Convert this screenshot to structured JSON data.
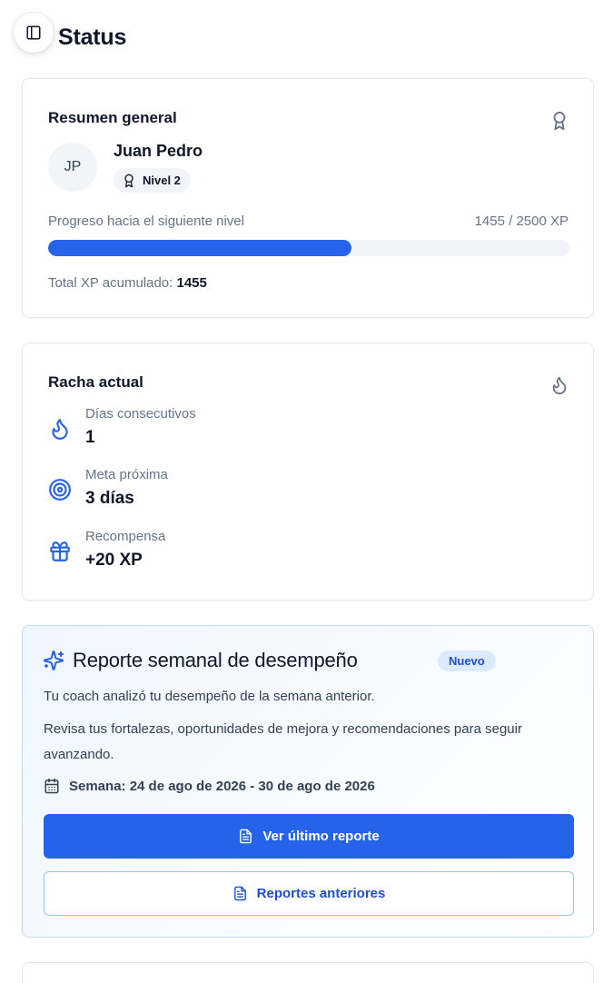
{
  "header": {
    "title": "Status",
    "toggle_icon": "sidebar-toggle-icon"
  },
  "summary": {
    "title": "Resumen general",
    "corner_icon": "award-icon",
    "avatar_initials": "JP",
    "user_name": "Juan Pedro",
    "level_label": "Nivel 2",
    "progress_label": "Progreso hacia el siguiente nivel",
    "progress_value_text": "1455 / 2500 XP",
    "progress_fraction": 0.582,
    "total_label": "Total XP acumulado:",
    "total_value": "1455"
  },
  "streak": {
    "title": "Racha actual",
    "corner_icon": "flame-icon",
    "items": [
      {
        "label": "Días consecutivos",
        "value": "1",
        "icon": "flame-icon"
      },
      {
        "label": "Meta próxima",
        "value": "3 días",
        "icon": "target-icon"
      },
      {
        "label": "Recompensa",
        "value": "+20 XP",
        "icon": "gift-icon"
      }
    ]
  },
  "report": {
    "title": "Reporte semanal de desempeño",
    "badge": "Nuevo",
    "text1": "Tu coach analizó tu desempeño de la semana anterior.",
    "text2": "Revisa tus fortalezas, oportunidades de mejora y recomendaciones para seguir avanzando.",
    "week_label": "Semana: 24 de ago de 2026 - 30 de ago de 2026",
    "primary_button": "Ver último reporte",
    "secondary_button": "Reportes anteriores"
  },
  "colors": {
    "accent": "#2563eb",
    "accent_dark": "#1d4ed8",
    "muted_text": "#64748b",
    "track": "#f1f5f9",
    "badge_bg": "#dbeafe"
  }
}
